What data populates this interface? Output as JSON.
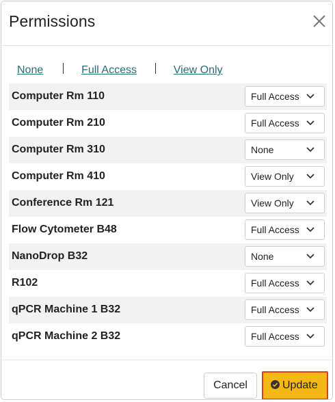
{
  "dialog": {
    "title": "Permissions",
    "close_icon": "close-icon"
  },
  "quick_links": {
    "none": "None",
    "full_access": "Full Access",
    "view_only": "View Only"
  },
  "permissions": [
    {
      "resource": "Computer Rm 110",
      "value": "Full Access"
    },
    {
      "resource": "Computer Rm 210",
      "value": "Full Access"
    },
    {
      "resource": "Computer Rm 310",
      "value": "None"
    },
    {
      "resource": "Computer Rm 410",
      "value": "View Only"
    },
    {
      "resource": "Conference Rm 121",
      "value": "View Only"
    },
    {
      "resource": "Flow Cytometer B48",
      "value": "Full Access"
    },
    {
      "resource": "NanoDrop B32",
      "value": "None"
    },
    {
      "resource": "R102",
      "value": "Full Access"
    },
    {
      "resource": "qPCR Machine 1 B32",
      "value": "Full Access"
    },
    {
      "resource": "qPCR Machine 2 B32",
      "value": "Full Access"
    }
  ],
  "footer": {
    "cancel_label": "Cancel",
    "update_label": "Update",
    "update_icon": "check-circle-icon"
  },
  "colors": {
    "link": "#2a6b73",
    "update_bg": "#f6b817",
    "update_border": "#e33a1c",
    "row_stripe": "#f2f2f2"
  }
}
